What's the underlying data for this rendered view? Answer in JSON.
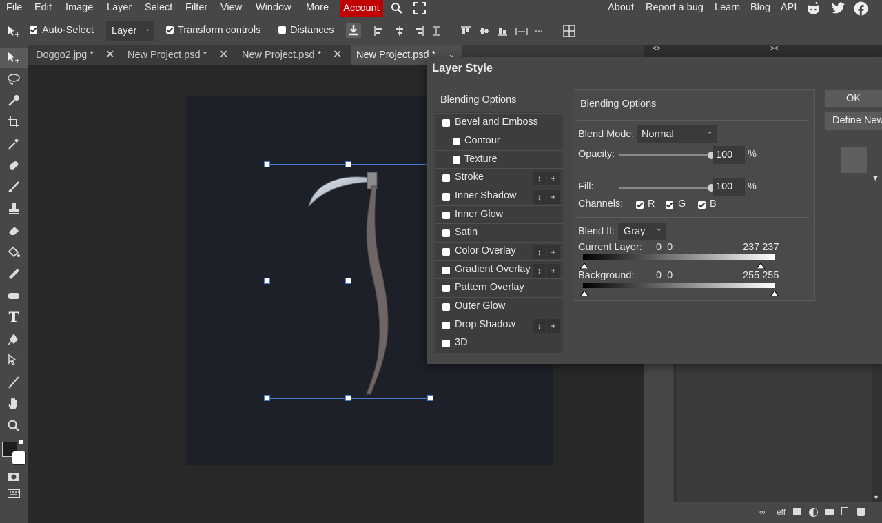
{
  "menu": {
    "file": "File",
    "edit": "Edit",
    "image": "Image",
    "layer": "Layer",
    "select": "Select",
    "filter": "Filter",
    "view": "View",
    "window": "Window",
    "more": "More",
    "account": "Account",
    "about": "About",
    "report": "Report a bug",
    "learn": "Learn",
    "blog": "Blog",
    "api": "API"
  },
  "toolbar": {
    "auto_select": "Auto-Select",
    "layer_select": "Layer",
    "transform_controls": "Transform controls",
    "distances": "Distances",
    "more": "..."
  },
  "tabs": [
    {
      "label": "Doggo2.jpg *"
    },
    {
      "label": "New Project.psd *"
    },
    {
      "label": "New Project.psd *"
    },
    {
      "label": "New Project.psd *"
    }
  ],
  "right_panel": {
    "toggle_left": "<>",
    "toggle_right": "><",
    "eff": "eff"
  },
  "dialog": {
    "title": "Layer Style",
    "ok": "OK",
    "define_new": "Define New",
    "styles": [
      {
        "label": "Blending Options"
      },
      {
        "label": "Bevel and Emboss"
      },
      {
        "label": "Contour"
      },
      {
        "label": "Texture"
      },
      {
        "label": "Stroke"
      },
      {
        "label": "Inner Shadow"
      },
      {
        "label": "Inner Glow"
      },
      {
        "label": "Satin"
      },
      {
        "label": "Color Overlay"
      },
      {
        "label": "Gradient Overlay"
      },
      {
        "label": "Pattern Overlay"
      },
      {
        "label": "Outer Glow"
      },
      {
        "label": "Drop Shadow"
      },
      {
        "label": "3D"
      }
    ],
    "mini_buttons": {
      "move": "↕",
      "add": "+"
    },
    "blend": {
      "heading": "Blending Options",
      "blend_mode_label": "Blend Mode:",
      "blend_mode_value": "Normal",
      "opacity_label": "Opacity:",
      "opacity_value": "100",
      "opacity_fraction": 1.0,
      "percent": "%",
      "fill_label": "Fill:",
      "fill_value": "100",
      "fill_fraction": 1.0,
      "channels_label": "Channels:",
      "channel_r": "R",
      "channel_g": "G",
      "channel_b": "B",
      "blend_if_label": "Blend If:",
      "blend_if_value": "Gray",
      "current_layer_label": "Current Layer:",
      "current_layer_low": "0  0",
      "current_layer_high": "237 237",
      "background_label": "Background:",
      "background_low": "0  0",
      "background_high": "255 255"
    }
  },
  "colors": {
    "account_bg": "#c00000",
    "selection_box": "#4a7bd0"
  }
}
